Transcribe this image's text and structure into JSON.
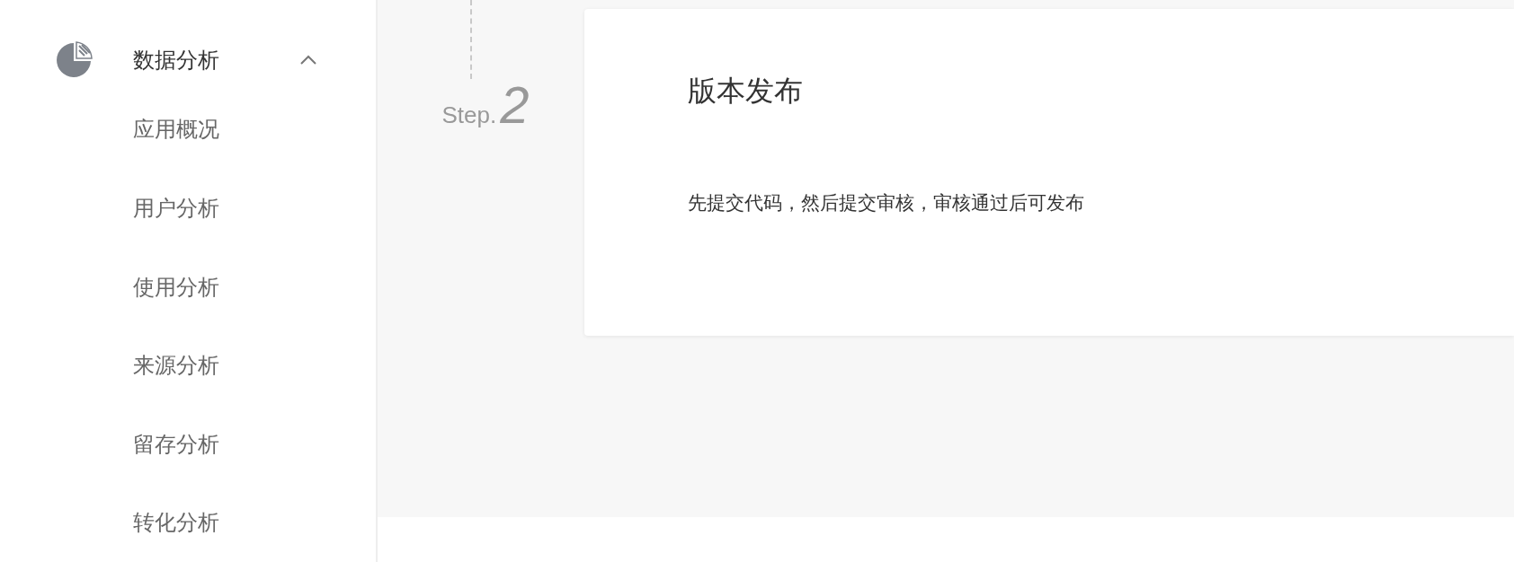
{
  "sidebar": {
    "group": {
      "label": "数据分析",
      "expanded": true
    },
    "items": [
      {
        "label": "应用概况",
        "selected": false
      },
      {
        "label": "用户分析",
        "selected": false
      },
      {
        "label": "使用分析",
        "selected": false
      },
      {
        "label": "来源分析",
        "selected": false
      },
      {
        "label": "留存分析",
        "selected": false
      },
      {
        "label": "转化分析",
        "selected": false
      }
    ]
  },
  "step": {
    "prefix": "Step.",
    "number": "2"
  },
  "card": {
    "title": "版本发布",
    "description": "先提交代码，然后提交审核，审核通过后可发布"
  }
}
